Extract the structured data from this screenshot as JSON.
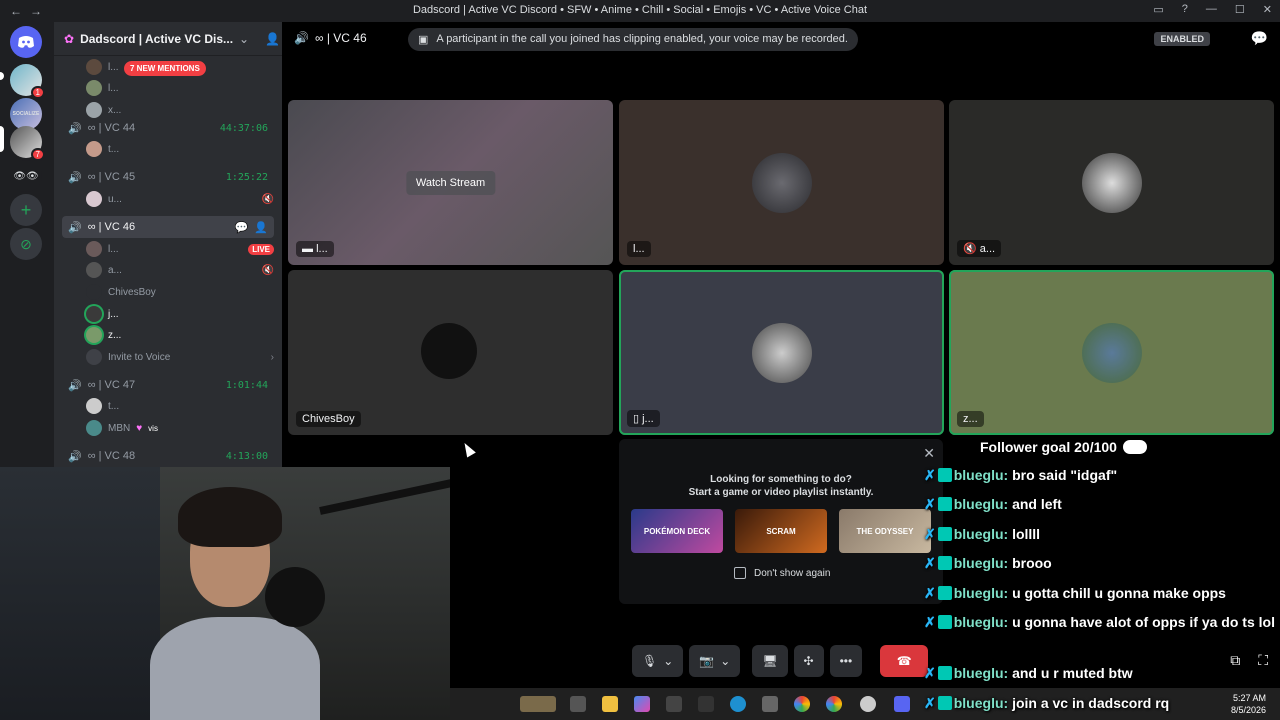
{
  "window": {
    "title": "Dadscord | Active VC Discord • SFW • Anime • Chill • Social • Emojis • VC • Active Voice Chat",
    "nav_back": "←",
    "nav_forward": "→",
    "controls": [
      "▭",
      "?",
      "—",
      "☐",
      "✕"
    ]
  },
  "rail": {
    "home_icon": "discord-logo",
    "servers": [
      {
        "label": "",
        "badge": "1"
      },
      {
        "label": "SOCIALIZE",
        "badge": ""
      },
      {
        "label": "",
        "badge": "7"
      },
      {
        "label": "👁👁",
        "badge": ""
      }
    ],
    "add_label": "+",
    "explore_label": "⊘"
  },
  "sidebar": {
    "server_name": "Dadscord | Active VC Dis...",
    "mentions": "7 NEW MENTIONS",
    "top_users": [
      "l...",
      "l...",
      "x..."
    ],
    "vcs": [
      {
        "name": "VC 44",
        "timer": "44:37:06",
        "users": [
          {
            "name": "t...",
            "right": ""
          }
        ]
      },
      {
        "name": "VC 45",
        "timer": "1:25:22",
        "users": [
          {
            "name": "u...",
            "right": "🔇"
          }
        ]
      },
      {
        "name": "VC 46",
        "timer": "",
        "users": [
          {
            "name": "l...",
            "right": "LIVE"
          },
          {
            "name": "a...",
            "right": "🔇"
          },
          {
            "name": "ChivesBoy",
            "right": ""
          },
          {
            "name": "j...",
            "right": ""
          },
          {
            "name": "z...",
            "right": ""
          }
        ],
        "invite": "Invite to Voice"
      },
      {
        "name": "VC 47",
        "timer": "1:01:44",
        "users": [
          {
            "name": "t...",
            "right": ""
          },
          {
            "name": "MBN",
            "right": "vis"
          }
        ]
      },
      {
        "name": "VC 48",
        "timer": "4:13:00",
        "users": []
      }
    ],
    "vc_prefix": "∞ |"
  },
  "call": {
    "title": "∞ | VC 46",
    "notice": "A participant in the call you joined has clipping enabled, your voice may be recorded.",
    "enabled": "ENABLED",
    "tiles": [
      {
        "label": "l...",
        "watch": "Watch Stream"
      },
      {
        "label": "l..."
      },
      {
        "label": "a..."
      },
      {
        "label": "ChivesBoy"
      },
      {
        "label": "j..."
      },
      {
        "label": "z..."
      }
    ],
    "activity": {
      "line1": "Looking for something to do?",
      "line2": "Start a game or video playlist instantly.",
      "games": [
        "POKÉMON DECK",
        "SCRAM",
        "THE ODYSSEY"
      ],
      "dont_show": "Don't show again"
    }
  },
  "overlay": {
    "goal": "Follower goal 20/100",
    "messages": [
      {
        "user": "blueglu:",
        "text": "bro said \"idgaf\""
      },
      {
        "user": "blueglu:",
        "text": "and left"
      },
      {
        "user": "blueglu:",
        "text": "lollll"
      },
      {
        "user": "blueglu:",
        "text": "brooo"
      },
      {
        "user": "blueglu:",
        "text": "u gotta chill u gonna make opps"
      },
      {
        "user": "blueglu:",
        "text": "u gonna have alot of opps if ya do ts lol"
      },
      {
        "user": "blueglu:",
        "text": "and u r muted btw"
      },
      {
        "user": "blueglu:",
        "text": "join a vc in dadscord rq"
      }
    ]
  },
  "taskbar": {
    "time": "5:27 AM",
    "date": "8/5/2026"
  }
}
